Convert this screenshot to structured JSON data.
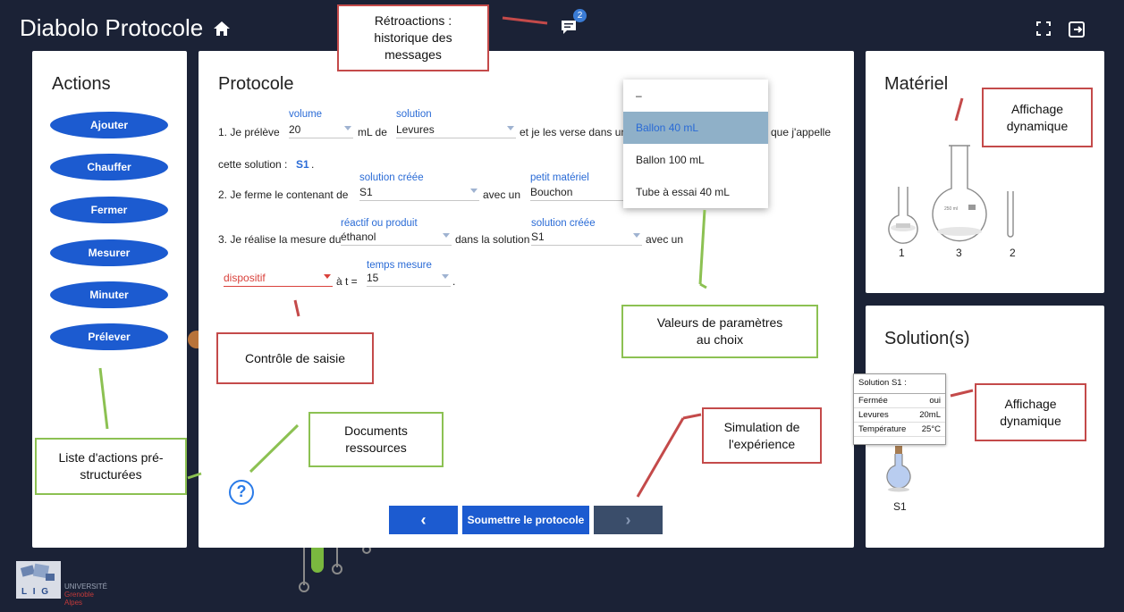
{
  "app": {
    "title": "Diabolo Protocole",
    "badge_count": "2"
  },
  "actions": {
    "title": "Actions",
    "buttons": [
      "Ajouter",
      "Chauffer",
      "Fermer",
      "Mesurer",
      "Minuter",
      "Prélever"
    ]
  },
  "protocole": {
    "title": "Protocole",
    "step1": {
      "prefix": "1. Je prélève",
      "volume_label": "volume",
      "volume_value": "20",
      "unit": "mL de",
      "solution_label": "solution",
      "solution_value": "Levures",
      "suffix": "et je les verse dans un",
      "suffix2": "que j'appelle",
      "line2_prefix": "cette solution :",
      "solution_name": "S1",
      "line2_suffix": "."
    },
    "step2": {
      "prefix": "2. Je ferme le contenant de",
      "created_label": "solution créée",
      "created_value": "S1",
      "middle": "avec un",
      "materiel_label": "petit matériel",
      "materiel_value": "Bouchon"
    },
    "step3": {
      "prefix": "3. Je réalise la mesure du",
      "reactif_label": "réactif ou produit",
      "reactif_value": "éthanol",
      "middle": "dans la solution",
      "created_label": "solution créée",
      "created_value": "S1",
      "suffix": "avec un",
      "dispositif_value": "dispositif",
      "at_label": "à t =",
      "temps_label": "temps mesure",
      "temps_value": "15",
      "end": "."
    },
    "dropdown_options": [
      "–",
      "Ballon 40 mL",
      "Ballon 100 mL",
      "Tube à essai 40 mL"
    ],
    "dropdown_selected": "Ballon 40 mL",
    "help_icon": "?",
    "buttons": {
      "prev": "‹",
      "submit": "Soumettre le protocole",
      "next": "›"
    }
  },
  "materiel": {
    "title": "Matériel",
    "items": [
      "1",
      "3",
      "2"
    ],
    "flask_text": "250 ml"
  },
  "solutions": {
    "title": "Solution(s)",
    "tooltip": {
      "title": "Solution S1 :",
      "rows": [
        {
          "k": "Fermée",
          "v": "oui"
        },
        {
          "k": "Levures",
          "v": "20mL"
        },
        {
          "k": "Température",
          "v": "25°C"
        }
      ]
    },
    "item_label": "S1"
  },
  "annotations": {
    "retroactions": "Rétroactions : historique des messages",
    "affichage1": "Affichage dynamique",
    "valeurs": "Valeurs de paramètres au choix",
    "controle": "Contrôle de saisie",
    "documents": "Documents ressources",
    "simulation": "Simulation de l'expérience",
    "affichage2": "Affichage dynamique",
    "liste": "Liste d'actions pré-structurées"
  },
  "footer": {
    "logo_text": "L I G",
    "univ_line1": "UNIVERSITÉ",
    "univ_line2": "Grenoble",
    "univ_line3": "Alpes"
  },
  "colors": {
    "background": "#1b2236",
    "action_button": "#1c5bd0",
    "label_blue": "#2a6bd6",
    "error_red": "#d9413b",
    "annotation_red": "#c44a4a",
    "annotation_green": "#8cc152"
  }
}
